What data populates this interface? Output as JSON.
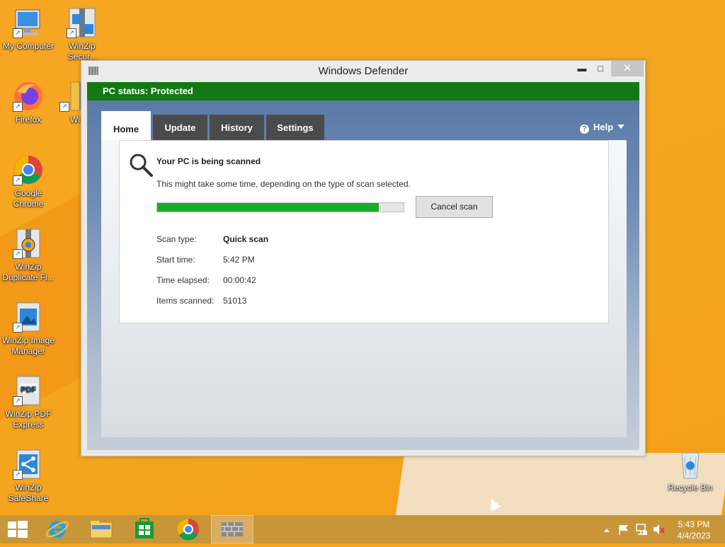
{
  "desktop": {
    "icons": [
      {
        "label": "My Computer"
      },
      {
        "label": "WinZip Secur..."
      },
      {
        "label": "Firefox"
      },
      {
        "label": "Wi"
      },
      {
        "label": "Google Chrome"
      },
      {
        "label": "WinZip Duplicate Fi..."
      },
      {
        "label": "WinZip Image Manager"
      },
      {
        "label": "WinZip PDF Express"
      },
      {
        "label": "WinZip SafeShare"
      },
      {
        "label": "Recycle Bin"
      }
    ]
  },
  "window": {
    "title": "Windows Defender",
    "minimize": "▬",
    "maximize": "□",
    "close": "✕",
    "status": "PC status: Protected",
    "tabs": [
      {
        "label": "Home"
      },
      {
        "label": "Update"
      },
      {
        "label": "History"
      },
      {
        "label": "Settings"
      }
    ],
    "help": "Help",
    "help_icon": "?",
    "scan": {
      "heading": "Your PC is being scanned",
      "description": "This might take some time, depending on the type of scan selected.",
      "progress_fraction": 0.9,
      "cancel_label": "Cancel scan",
      "rows": [
        {
          "label": "Scan type:",
          "value": "Quick scan"
        },
        {
          "label": "Start time:",
          "value": "5:42 PM"
        },
        {
          "label": "Time elapsed:",
          "value": "00:00:42"
        },
        {
          "label": "Items scanned:",
          "value": "51013"
        }
      ]
    }
  },
  "taskbar": {
    "time": "5:43 PM",
    "date": "4/4/2023"
  },
  "colors": {
    "status_green": "#137a13",
    "progress_green": "#14ad2a",
    "desktop_orange": "#f6a623",
    "taskbar": "#c89638"
  }
}
